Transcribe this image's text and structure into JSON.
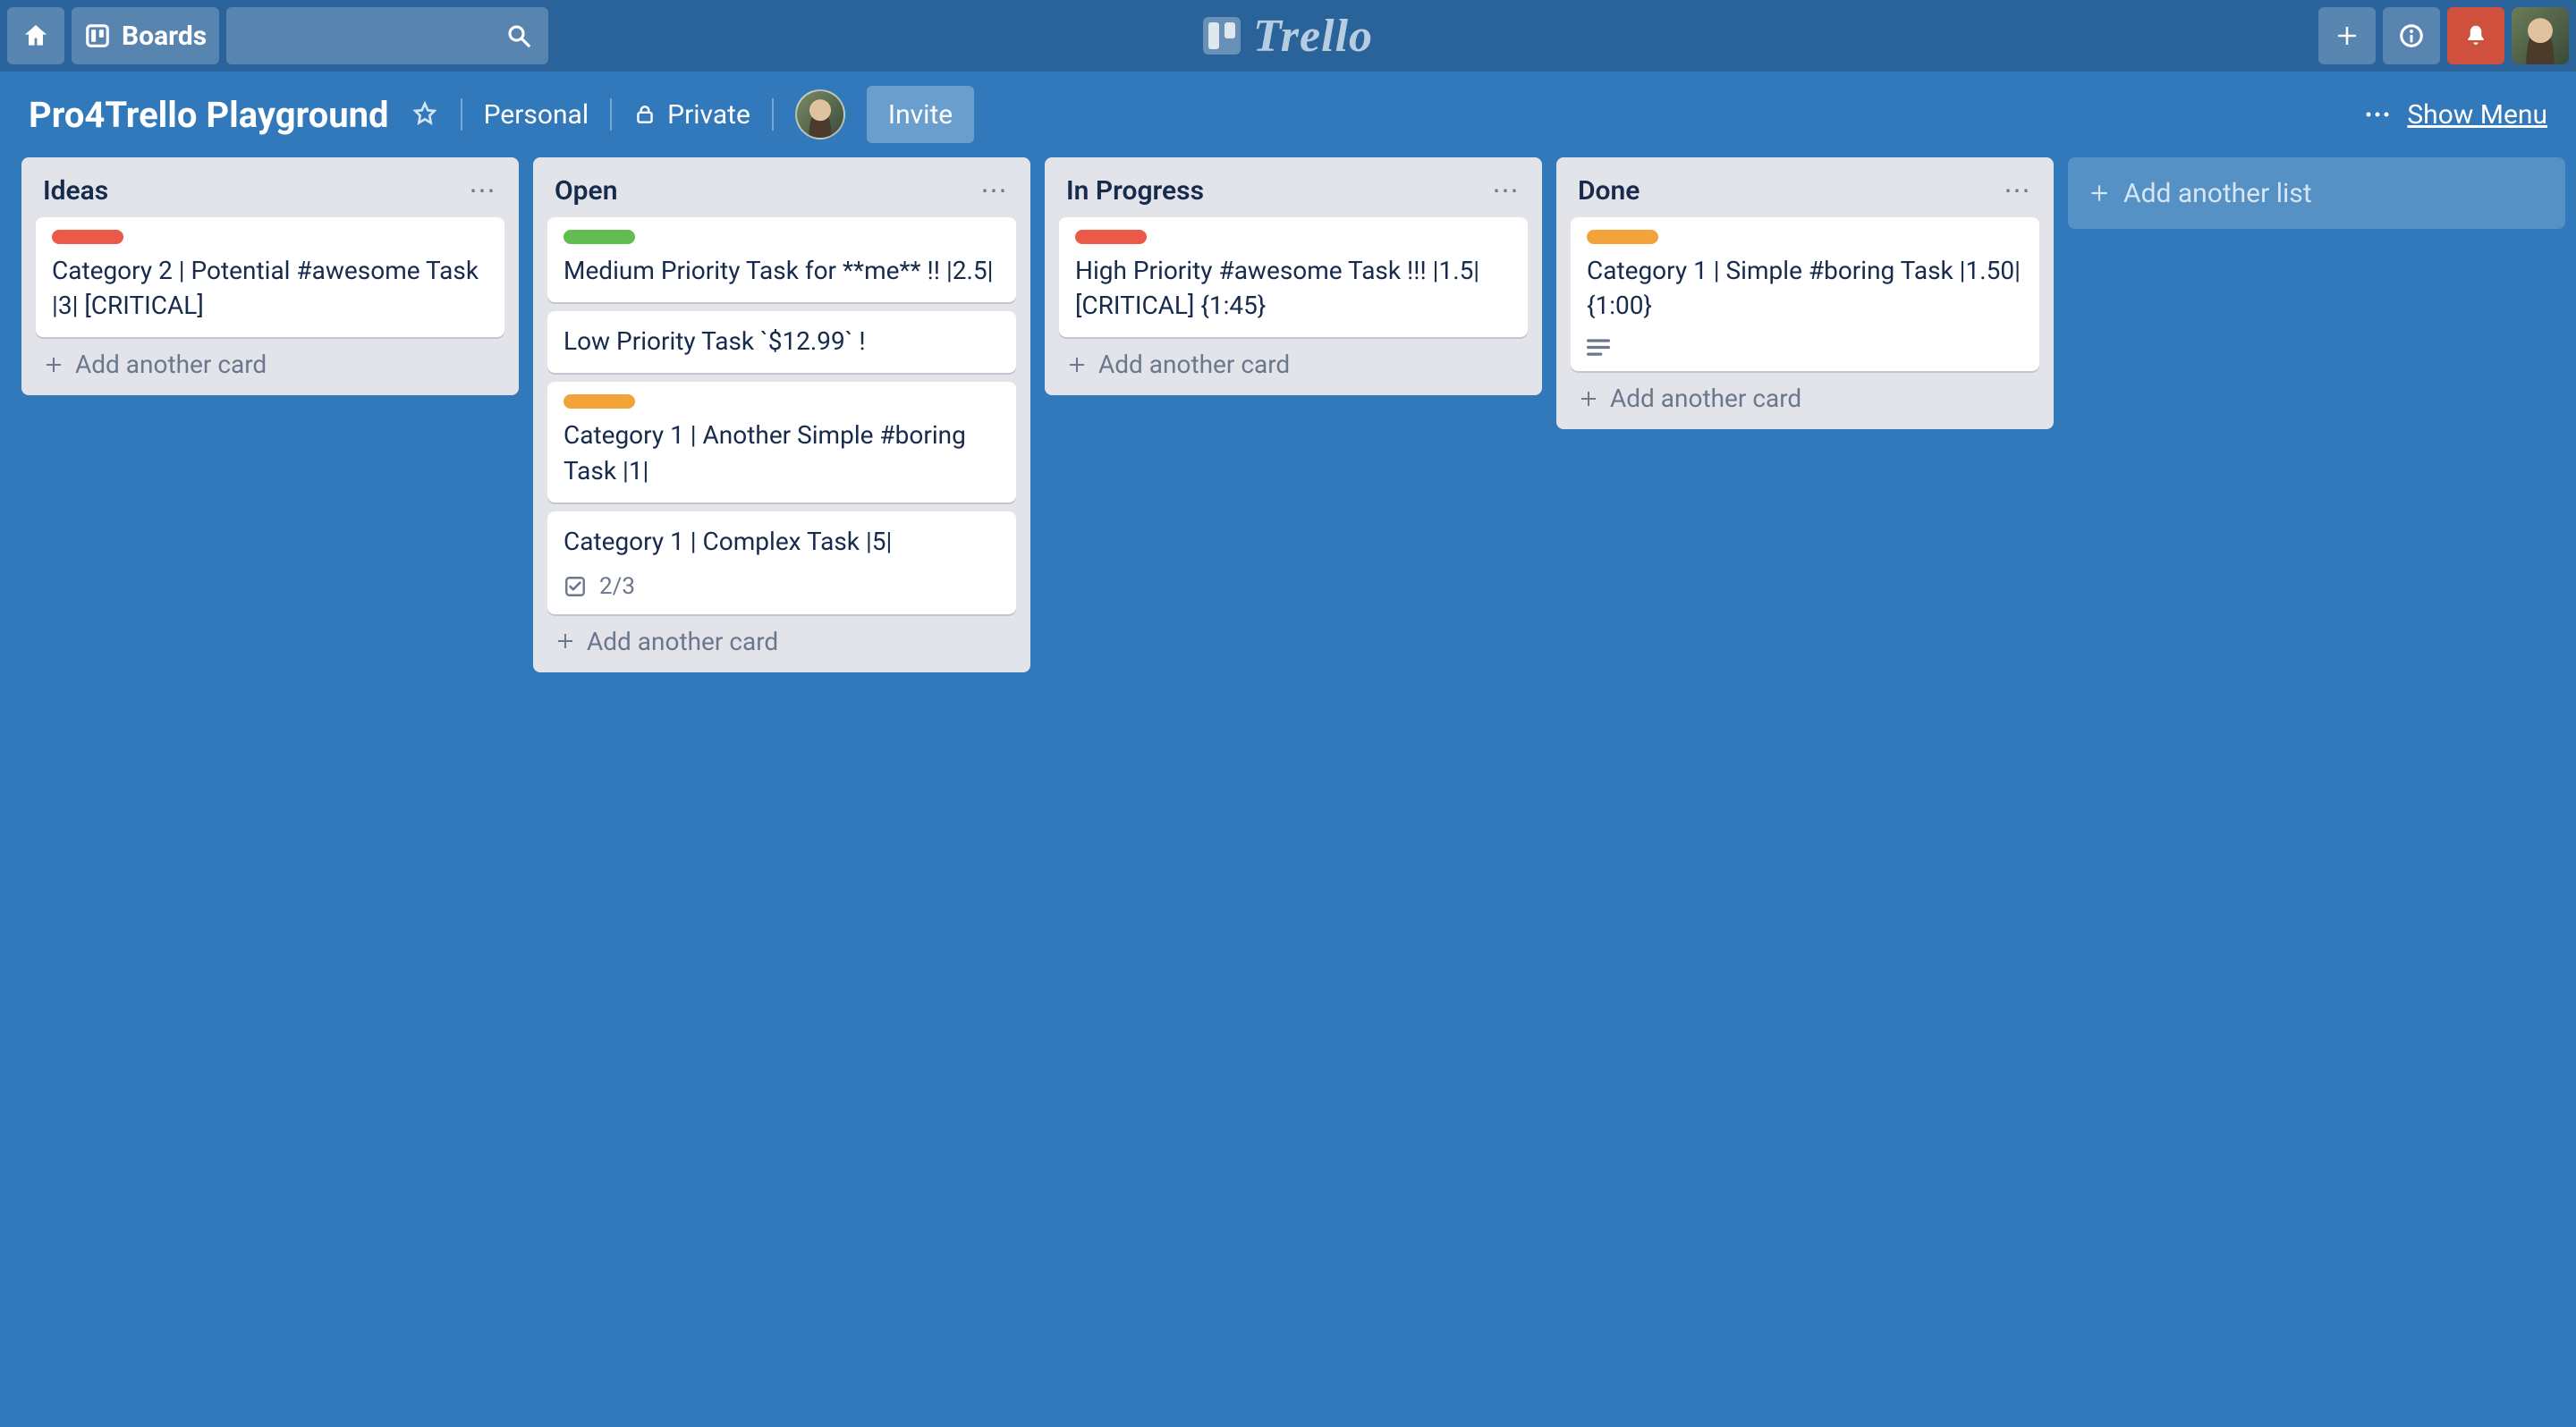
{
  "header": {
    "boards_label": "Boards",
    "logo_text": "Trello"
  },
  "board_header": {
    "title": "Pro4Trello Playground",
    "team": "Personal",
    "visibility": "Private",
    "invite_label": "Invite",
    "show_menu_label": "Show Menu"
  },
  "labels": {
    "add_card": "Add another card",
    "add_list": "Add another list"
  },
  "lists": [
    {
      "title": "Ideas",
      "cards": [
        {
          "label_color": "red",
          "title": "Category 2 | Potential #awesome Task |3| [CRITICAL]"
        }
      ]
    },
    {
      "title": "Open",
      "cards": [
        {
          "label_color": "green",
          "title": "Medium Priority Task for **me** !! |2.5|"
        },
        {
          "label_color": "",
          "title": "Low Priority Task `$12.99` !"
        },
        {
          "label_color": "orange",
          "title": "Category 1 | Another Simple #boring Task |1|"
        },
        {
          "label_color": "",
          "title": "Category 1 | Complex Task |5|",
          "checklist": "2/3"
        }
      ]
    },
    {
      "title": "In Progress",
      "cards": [
        {
          "label_color": "red",
          "title": "High Priority #awesome Task !!! |1.5| [CRITICAL] {1:45}"
        }
      ]
    },
    {
      "title": "Done",
      "cards": [
        {
          "label_color": "orange",
          "title": "Category 1 | Simple #boring Task |1.50| {1:00}",
          "has_description": true
        }
      ]
    }
  ]
}
